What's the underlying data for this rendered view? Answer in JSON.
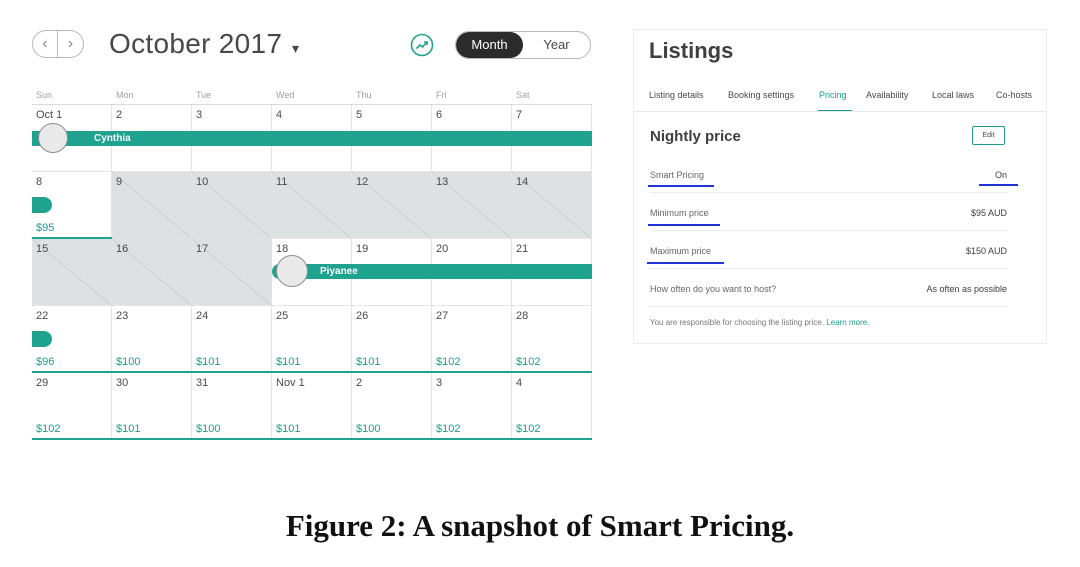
{
  "calendar": {
    "month_label": "October 2017",
    "caret": "▾",
    "prev_icon": "‹",
    "next_icon": "›",
    "view_month": "Month",
    "view_year": "Year",
    "weekdays": [
      "Sun",
      "Mon",
      "Tue",
      "Wed",
      "Thu",
      "Fri",
      "Sat"
    ],
    "weeks": [
      [
        {
          "day": "Oct 1",
          "price": ""
        },
        {
          "day": "2",
          "price": ""
        },
        {
          "day": "3",
          "price": ""
        },
        {
          "day": "4",
          "price": ""
        },
        {
          "day": "5",
          "price": ""
        },
        {
          "day": "6",
          "price": ""
        },
        {
          "day": "7",
          "price": ""
        }
      ],
      [
        {
          "day": "8",
          "price": "$95"
        },
        {
          "day": "9",
          "price": ""
        },
        {
          "day": "10",
          "price": ""
        },
        {
          "day": "11",
          "price": ""
        },
        {
          "day": "12",
          "price": ""
        },
        {
          "day": "13",
          "price": ""
        },
        {
          "day": "14",
          "price": ""
        }
      ],
      [
        {
          "day": "15",
          "price": ""
        },
        {
          "day": "16",
          "price": ""
        },
        {
          "day": "17",
          "price": ""
        },
        {
          "day": "18",
          "price": ""
        },
        {
          "day": "19",
          "price": ""
        },
        {
          "day": "20",
          "price": ""
        },
        {
          "day": "21",
          "price": ""
        }
      ],
      [
        {
          "day": "22",
          "price": "$96"
        },
        {
          "day": "23",
          "price": "$100"
        },
        {
          "day": "24",
          "price": "$101"
        },
        {
          "day": "25",
          "price": "$101"
        },
        {
          "day": "26",
          "price": "$101"
        },
        {
          "day": "27",
          "price": "$102"
        },
        {
          "day": "28",
          "price": "$102"
        }
      ],
      [
        {
          "day": "29",
          "price": "$102"
        },
        {
          "day": "30",
          "price": "$101"
        },
        {
          "day": "31",
          "price": "$100"
        },
        {
          "day": "Nov 1",
          "price": "$101"
        },
        {
          "day": "2",
          "price": "$100"
        },
        {
          "day": "3",
          "price": "$102"
        },
        {
          "day": "4",
          "price": "$102"
        }
      ]
    ],
    "bookings": {
      "cynthia": "Cynthia",
      "piyanee": "Piyanee"
    }
  },
  "listings": {
    "title": "Listings",
    "tabs": [
      "Listing details",
      "Booking settings",
      "Pricing",
      "Availability",
      "Local laws",
      "Co-hosts"
    ],
    "section_title": "Nightly price",
    "edit_label": "Edit",
    "rows": [
      {
        "label": "Smart Pricing",
        "value": "On"
      },
      {
        "label": "Minimum price",
        "value": "$95 AUD"
      },
      {
        "label": "Maximum price",
        "value": "$150 AUD"
      },
      {
        "label": "How often do you want to host?",
        "value": "As often as possible"
      }
    ],
    "footnote": "You are responsible for choosing the listing price.",
    "footnote_link": "Learn more."
  },
  "caption": "Figure 2: A snapshot of Smart Pricing."
}
